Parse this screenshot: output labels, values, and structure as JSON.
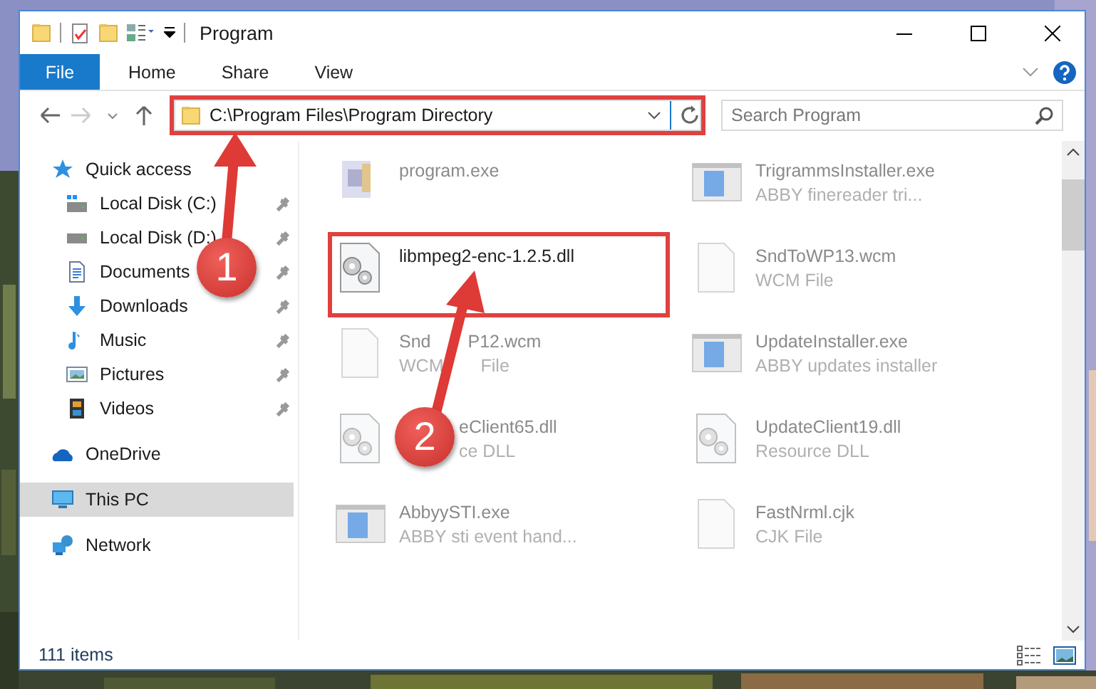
{
  "window": {
    "title": "Program"
  },
  "ribbon_tabs": [
    {
      "label": "File",
      "kind": "menu"
    },
    {
      "label": "Home",
      "kind": "tab"
    },
    {
      "label": "Share",
      "kind": "tab"
    },
    {
      "label": "View",
      "kind": "tab"
    }
  ],
  "address": {
    "path": "C:\\Program Files\\Program Directory",
    "outlined": true
  },
  "search": {
    "placeholder": "Search Program"
  },
  "nav": {
    "items": [
      {
        "label": "Quick access",
        "selected": false,
        "children": [
          {
            "label": "Local Disk (C:)",
            "pinned": true
          },
          {
            "label": "Local Disk (D:)",
            "pinned": true
          },
          {
            "label": "Documents",
            "pinned": true
          },
          {
            "label": "Downloads",
            "pinned": true
          },
          {
            "label": "Music",
            "pinned": true
          },
          {
            "label": "Pictures",
            "pinned": true
          },
          {
            "label": "Videos",
            "pinned": true
          }
        ]
      },
      {
        "label": "OneDrive",
        "selected": false
      },
      {
        "label": "This PC",
        "selected": true
      },
      {
        "label": "Network",
        "selected": false
      }
    ]
  },
  "files": [
    {
      "name": "program.exe",
      "kind": "setup",
      "faded": true,
      "outlined": false
    },
    {
      "name": "TrigrammsInstaller.exe",
      "description": "ABBY finereader tri...",
      "kind": "window",
      "faded": true,
      "outlined": false
    },
    {
      "name": "libmpeg2-enc-1.2.5.dll",
      "kind": "gears",
      "faded": false,
      "outlined": true
    },
    {
      "name": "SndToWP13.wcm",
      "description": "WCM File",
      "kind": "document",
      "faded": true,
      "outlined": false
    },
    {
      "name_parts": [
        "Snd",
        "P12.wcm"
      ],
      "description_parts": [
        "WCM",
        "File"
      ],
      "kind": "document",
      "faded": true,
      "outlined": false
    },
    {
      "name": "UpdateInstaller.exe",
      "description": "ABBY updates installer",
      "kind": "window",
      "faded": true,
      "outlined": false
    },
    {
      "name": "eClient65.dll",
      "description": "ce DLL",
      "kind": "gears",
      "faded": true,
      "outlined": false,
      "covered": true
    },
    {
      "name": "UpdateClient19.dll",
      "description": "Resource DLL",
      "kind": "gears",
      "faded": true,
      "outlined": false
    },
    {
      "name": "AbbyySTI.exe",
      "description": "ABBY sti event hand...",
      "kind": "window",
      "faded": true,
      "outlined": false
    },
    {
      "name": "FastNrml.cjk",
      "description": "CJK File",
      "kind": "document",
      "faded": true,
      "outlined": false
    }
  ],
  "status_bar": {
    "count": "111 items"
  },
  "callouts": [
    {
      "number": "1"
    },
    {
      "number": "2"
    }
  ]
}
